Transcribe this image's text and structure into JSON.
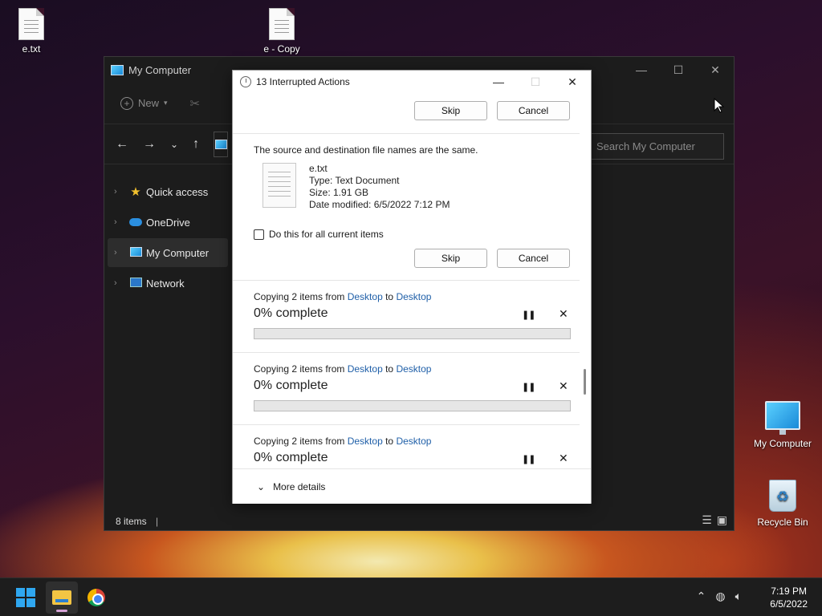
{
  "desktop": {
    "icons": [
      {
        "label": "e.txt"
      },
      {
        "label": "e - Copy"
      },
      {
        "label": "My Computer"
      },
      {
        "label": "Recycle Bin"
      }
    ]
  },
  "explorer": {
    "title": "My Computer",
    "toolbar": {
      "new_label": "New"
    },
    "search_placeholder": "Search My Computer",
    "nav": [
      {
        "label": "Quick access",
        "icon": "star-icon"
      },
      {
        "label": "OneDrive",
        "icon": "cloud-icon"
      },
      {
        "label": "My Computer",
        "icon": "computer-icon",
        "selected": true
      },
      {
        "label": "Network",
        "icon": "network-icon"
      }
    ],
    "status": "8 items"
  },
  "dialog": {
    "title": "13 Interrupted Actions",
    "top_buttons": {
      "skip": "Skip",
      "cancel": "Cancel"
    },
    "conflict": {
      "message": "The source and destination file names are the same.",
      "file_name": "e.txt",
      "file_type": "Type: Text Document",
      "file_size": "Size: 1.91 GB",
      "file_modified": "Date modified: 6/5/2022 7:12 PM",
      "checkbox_label": "Do this for all current items",
      "skip": "Skip",
      "cancel": "Cancel"
    },
    "operations": [
      {
        "prefix": "Copying 2 items from ",
        "from": "Desktop",
        "mid": " to ",
        "to": "Desktop",
        "percent": "0% complete",
        "progress": 0
      },
      {
        "prefix": "Copying 2 items from ",
        "from": "Desktop",
        "mid": " to ",
        "to": "Desktop",
        "percent": "0% complete",
        "progress": 0
      },
      {
        "prefix": "Copying 2 items from ",
        "from": "Desktop",
        "mid": " to ",
        "to": "Desktop",
        "percent": "0% complete",
        "progress": 0
      }
    ],
    "more_details": "More details"
  },
  "taskbar": {
    "time": "7:19 PM",
    "date": "6/5/2022"
  },
  "colors": {
    "link": "#1f5fa8",
    "progress": "#06b025",
    "accent": "#2fa7f0"
  }
}
